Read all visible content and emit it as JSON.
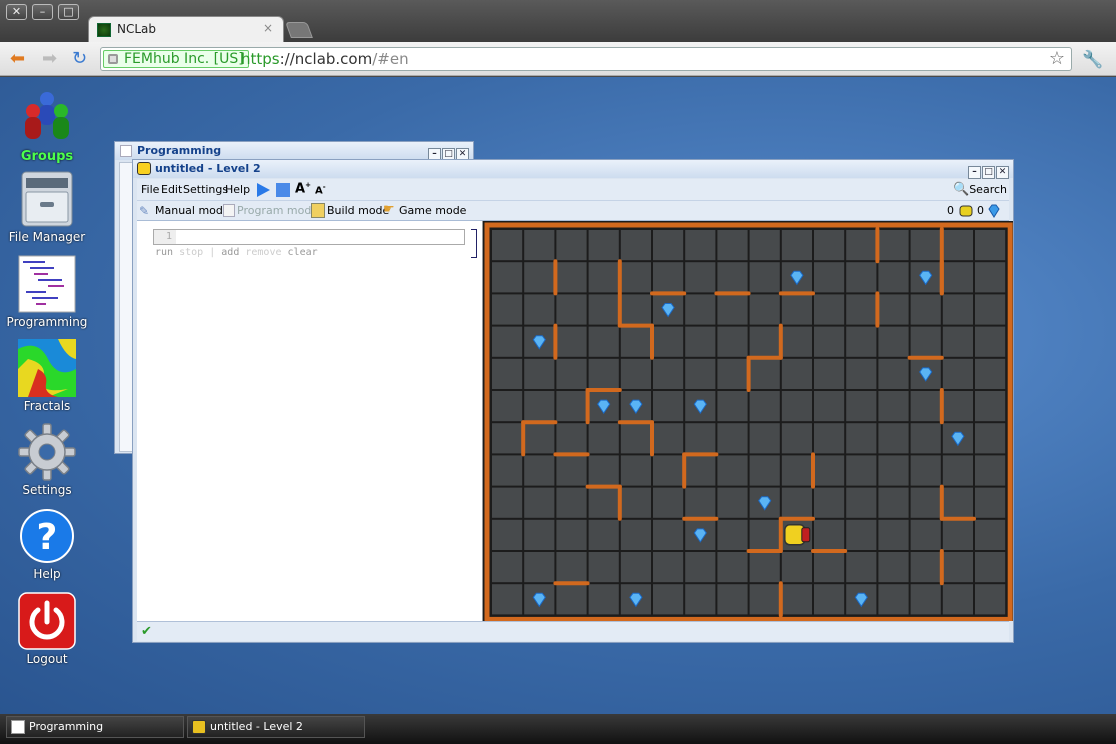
{
  "browser": {
    "window_buttons": [
      "✕",
      "–",
      "□"
    ],
    "tab_title": "NCLab",
    "tab_close": "×",
    "ssl_label": "FEMhub Inc. [US]",
    "url_scheme": "https",
    "url_sep": "://",
    "url_host": "nclab.com",
    "url_hash": "/#en"
  },
  "desktop": {
    "icons": [
      {
        "label": "Groups",
        "icon": "groups-icon"
      },
      {
        "label": "File Manager",
        "icon": "file-manager-icon"
      },
      {
        "label": "Programming",
        "icon": "programming-icon"
      },
      {
        "label": "Fractals",
        "icon": "fractals-icon"
      },
      {
        "label": "Settings",
        "icon": "settings-icon"
      },
      {
        "label": "Help",
        "icon": "help-icon"
      },
      {
        "label": "Logout",
        "icon": "logout-icon"
      }
    ],
    "help_glyph": "?"
  },
  "programming_window": {
    "title": "Programming"
  },
  "level_window": {
    "title": "untitled - Level 2",
    "menu": [
      "File",
      "Edit",
      "Settings",
      "Help"
    ],
    "search_label": "Search",
    "modes": [
      "Manual mode",
      "Program mode",
      "Build mode",
      "Game mode"
    ],
    "score_left": "0",
    "score_right": "0",
    "editor_line": "1",
    "commands": [
      "run",
      "stop",
      "add",
      "remove",
      "clear"
    ]
  },
  "maze": {
    "cols": 16,
    "rows": 12,
    "gems": [
      [
        9,
        1
      ],
      [
        13,
        1
      ],
      [
        5,
        2
      ],
      [
        1,
        3
      ],
      [
        13,
        4
      ],
      [
        3,
        5
      ],
      [
        4,
        5
      ],
      [
        6,
        5
      ],
      [
        14,
        6
      ],
      [
        8,
        8
      ],
      [
        6,
        9
      ],
      [
        1,
        11
      ],
      [
        4,
        11
      ],
      [
        11,
        11
      ]
    ],
    "robot": [
      9,
      9
    ],
    "wall_color": "#d2691e"
  },
  "taskbar": {
    "items": [
      "Programming",
      "untitled - Level 2"
    ]
  }
}
